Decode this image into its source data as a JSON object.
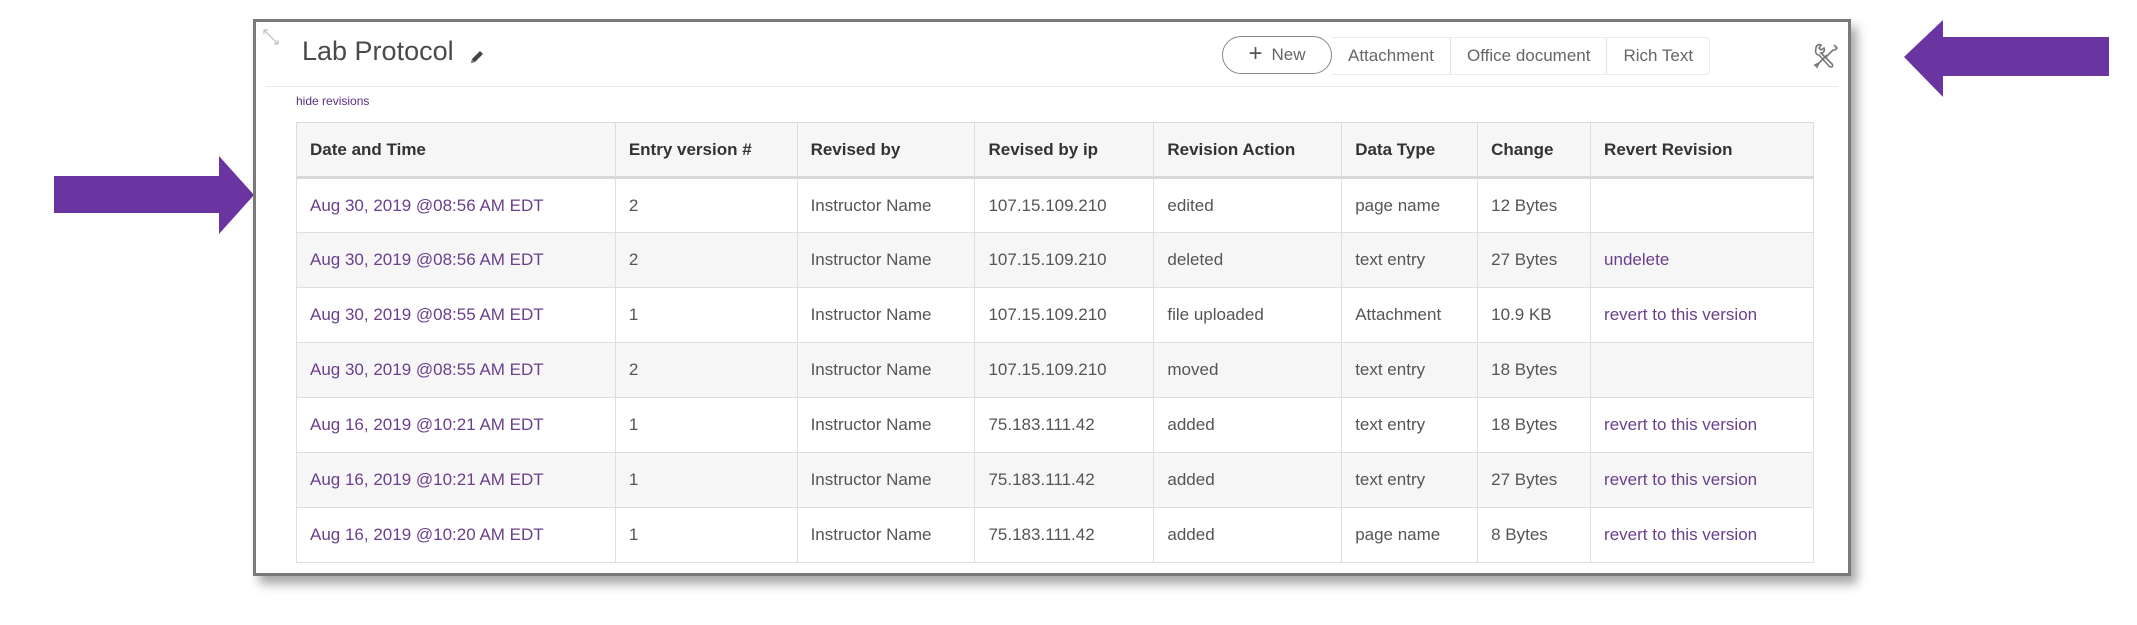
{
  "annotations": {
    "arrow_color": "#6a35a0",
    "arrows": [
      "pointing-right-at-first-row",
      "pointing-left-at-settings"
    ]
  },
  "page": {
    "title": "Lab Protocol",
    "hide_revisions_label": "hide revisions",
    "new_button_label": "New",
    "type_tabs": [
      "Attachment",
      "Office document",
      "Rich Text"
    ],
    "icons": {
      "resize": "resize-diagonal-icon",
      "edit": "pencil-icon",
      "add": "plus-icon",
      "settings": "wrench-screwdriver-icon"
    }
  },
  "table": {
    "columns": [
      "Date and Time",
      "Entry version #",
      "Revised by",
      "Revised by ip",
      "Revision Action",
      "Data Type",
      "Change",
      "Revert Revision"
    ],
    "rows": [
      {
        "datetime": "Aug 30, 2019 @08:56 AM EDT",
        "version": "2",
        "revised_by": "Instructor Name",
        "ip": "107.15.109.210",
        "action": "edited",
        "data_type": "page name",
        "change": "12 Bytes",
        "revert": ""
      },
      {
        "datetime": "Aug 30, 2019 @08:56 AM EDT",
        "version": "2",
        "revised_by": "Instructor Name",
        "ip": "107.15.109.210",
        "action": "deleted",
        "data_type": "text entry",
        "change": "27 Bytes",
        "revert": "undelete"
      },
      {
        "datetime": "Aug 30, 2019 @08:55 AM EDT",
        "version": "1",
        "revised_by": "Instructor Name",
        "ip": "107.15.109.210",
        "action": "file uploaded",
        "data_type": "Attachment",
        "change": "10.9 KB",
        "revert": "revert to this version"
      },
      {
        "datetime": "Aug 30, 2019 @08:55 AM EDT",
        "version": "2",
        "revised_by": "Instructor Name",
        "ip": "107.15.109.210",
        "action": "moved",
        "data_type": "text entry",
        "change": "18 Bytes",
        "revert": ""
      },
      {
        "datetime": "Aug 16, 2019 @10:21 AM EDT",
        "version": "1",
        "revised_by": "Instructor Name",
        "ip": "75.183.111.42",
        "action": "added",
        "data_type": "text entry",
        "change": "18 Bytes",
        "revert": "revert to this version"
      },
      {
        "datetime": "Aug 16, 2019 @10:21 AM EDT",
        "version": "1",
        "revised_by": "Instructor Name",
        "ip": "75.183.111.42",
        "action": "added",
        "data_type": "text entry",
        "change": "27 Bytes",
        "revert": "revert to this version"
      },
      {
        "datetime": "Aug 16, 2019 @10:20 AM EDT",
        "version": "1",
        "revised_by": "Instructor Name",
        "ip": "75.183.111.42",
        "action": "added",
        "data_type": "page name",
        "change": "8 Bytes",
        "revert": "revert to this version"
      }
    ]
  }
}
